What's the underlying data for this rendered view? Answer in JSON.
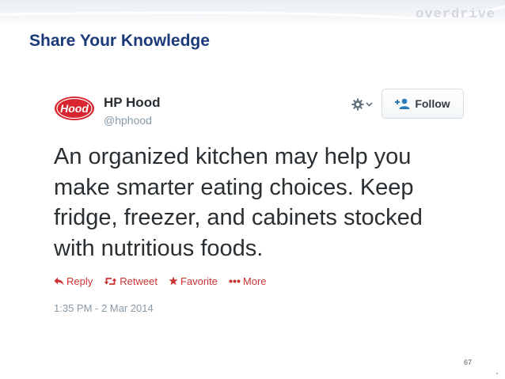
{
  "slide": {
    "title": "Share Your Knowledge",
    "brand": "overdrive",
    "page_number": "67"
  },
  "tweet": {
    "logo_text": "Hood",
    "display_name": "HP Hood",
    "handle": "@hphood",
    "follow_label": "Follow",
    "text_lines": [
      "An organized kitchen may help you",
      "make smarter eating choices. Keep",
      "fridge, freezer, and cabinets stocked",
      "with nutritious foods."
    ],
    "actions": {
      "reply": "Reply",
      "retweet": "Retweet",
      "favorite": "Favorite",
      "more": "More"
    },
    "timestamp": "1:35 PM - 2 Mar 2014"
  },
  "icons": {
    "brand_logo": "hood-logo-icon",
    "settings": "gear-icon",
    "dropdown": "chevron-down-icon",
    "follow": "add-user-icon",
    "reply": "reply-arrow-icon",
    "retweet": "retweet-icon",
    "favorite": "star-icon",
    "more": "ellipsis-icon"
  },
  "colors": {
    "title": "#1c3a78",
    "logo_red": "#d7262f",
    "action_red": "#cc3333",
    "tweet_text": "#292f33",
    "muted": "#8899a6"
  }
}
